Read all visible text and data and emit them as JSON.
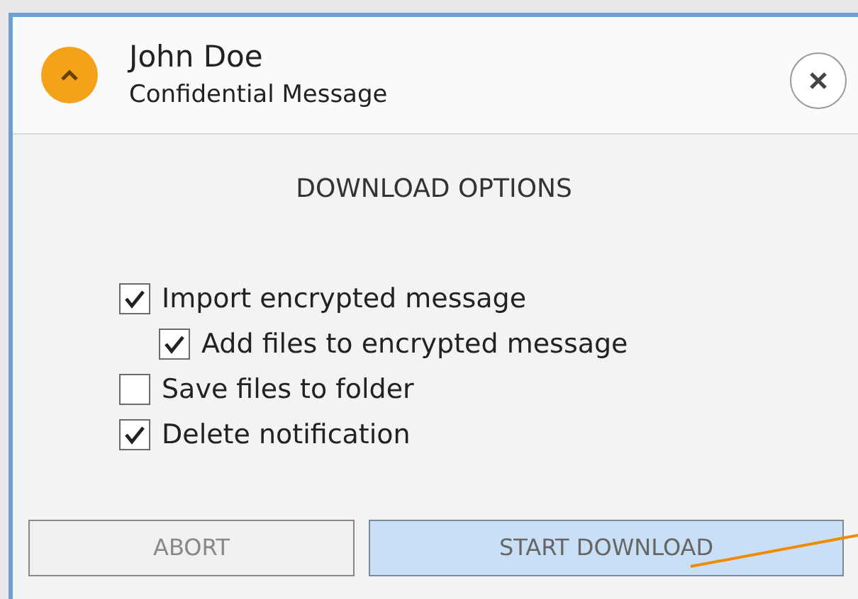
{
  "header": {
    "name": "John Doe",
    "subtitle": "Confidential Message"
  },
  "title": "DOWNLOAD OPTIONS",
  "options": [
    {
      "label": "Import encrypted message",
      "checked": true,
      "children": [
        {
          "label": "Add files to encrypted message",
          "checked": true
        }
      ]
    },
    {
      "label": "Save files to folder",
      "checked": false
    },
    {
      "label": "Delete notification",
      "checked": true
    }
  ],
  "buttons": [
    {
      "label": "ABORT",
      "highlighted": false
    },
    {
      "label": "START DOWNLOAD",
      "highlighted": true
    }
  ]
}
